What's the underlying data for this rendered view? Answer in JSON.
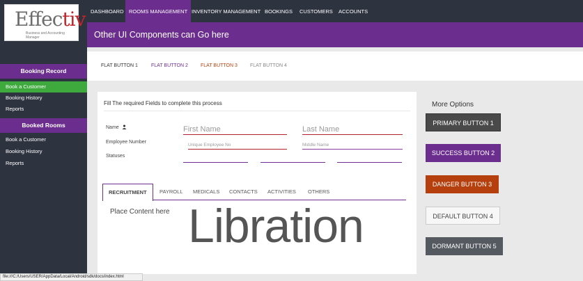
{
  "logo": {
    "text_prefix": "Effec",
    "text_accent": "tiv",
    "tagline": "Business and Accounting Manager"
  },
  "nav": {
    "items": [
      "DASHBOARD",
      "ROOMS MANAGEMENT",
      "INVENTORY MANAGEMENT",
      "BOOKINGS",
      "CUSTOMERS",
      "ACCOUNTS"
    ],
    "active": "ROOMS MANAGEMENT"
  },
  "banner": {
    "text": "Other UI Components can Go here"
  },
  "sidebar": {
    "booking_record": {
      "title": "Booking Record",
      "items": [
        "Book a Customer",
        "Booking History",
        "Reports"
      ]
    },
    "booked_rooms": {
      "title": "Booked Rooms",
      "items": [
        "Book a Customer",
        "Booking History",
        "Reports"
      ]
    }
  },
  "flat_buttons": [
    "FLAT BUTTON 1",
    "FLAT BUTTON 2",
    "FLAT BUTTON 3",
    "FLAT BUTTON 4"
  ],
  "form": {
    "title": "Fill The required Fields to complete this process",
    "name_label": "Name",
    "first_name_placeholder": "First Name",
    "last_name_placeholder": "Last Name",
    "employee_number_label": "Employee Number",
    "employee_no_placeholder": "Unique Employee No",
    "middle_name_placeholder": "Middle Name",
    "statuses_label": "Statuses"
  },
  "tabs": [
    "RECRUITMENT",
    "PAYROLL",
    "MEDICALS",
    "CONTACTS",
    "ACTIVITIES",
    "OTHERS"
  ],
  "tab_content": "Place Content here",
  "watermark": "Libration",
  "more_options": {
    "title": "More Options",
    "buttons": [
      "PRIMARY BUTTON 1",
      "SUCCESS BUTTON 2",
      "DANGER BUTTON 3",
      "DEFAULT BUTTON 4",
      "DORMANT BUTTON 5"
    ]
  },
  "status_url": "file:///C:/Users/USER/AppData/Local/Android/sdk/docs/index.html",
  "colors": {
    "purple": "#6b2d8e",
    "navy": "#2e3340",
    "green": "#3eaa3e",
    "danger": "#b5400e",
    "brand_red": "#c0262c"
  }
}
